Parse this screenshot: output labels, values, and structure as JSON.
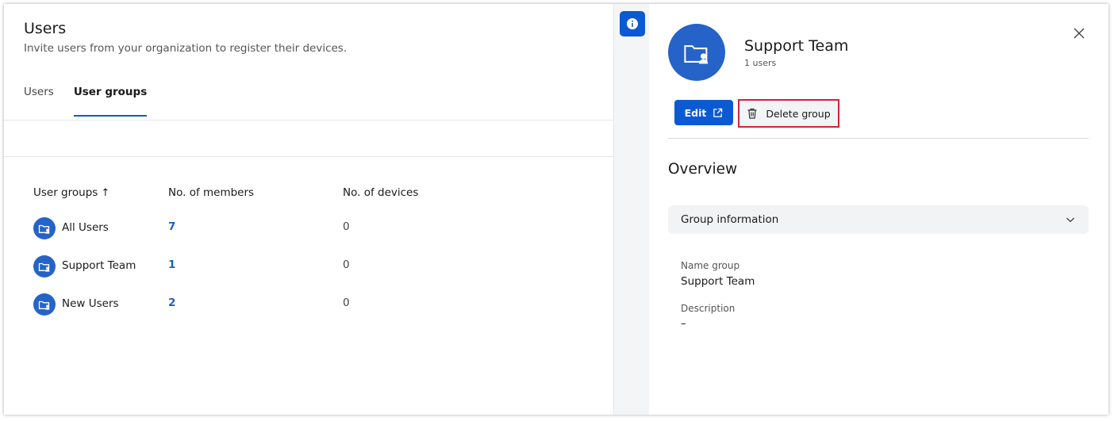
{
  "header": {
    "title": "Users",
    "subtitle": "Invite users from your organization to register their devices."
  },
  "tabs": [
    {
      "label": "Users",
      "active": false
    },
    {
      "label": "User groups",
      "active": true
    }
  ],
  "table": {
    "columns": {
      "name": "User groups",
      "sort_arrow": "↑",
      "members": "No. of members",
      "devices": "No. of devices"
    },
    "rows": [
      {
        "name": "All Users",
        "members": "7",
        "devices": "0"
      },
      {
        "name": "Support Team",
        "members": "1",
        "devices": "0"
      },
      {
        "name": "New Users",
        "members": "2",
        "devices": "0"
      }
    ]
  },
  "panel": {
    "title": "Support Team",
    "subtitle": "1 users",
    "edit_label": "Edit",
    "delete_label": "Delete group",
    "overview_heading": "Overview",
    "accordion_label": "Group information",
    "fields": [
      {
        "label": "Name group",
        "value": "Support Team"
      },
      {
        "label": "Description",
        "value": "–"
      }
    ]
  },
  "colors": {
    "accent": "#0b5ad3",
    "icon_bg": "#2563c9",
    "highlight_border": "#d0243b"
  },
  "icons": {
    "info": "info-icon",
    "close": "close-icon",
    "group": "user-group-icon",
    "external": "external-link-icon",
    "trash": "trash-icon",
    "chevron": "chevron-down-icon"
  }
}
